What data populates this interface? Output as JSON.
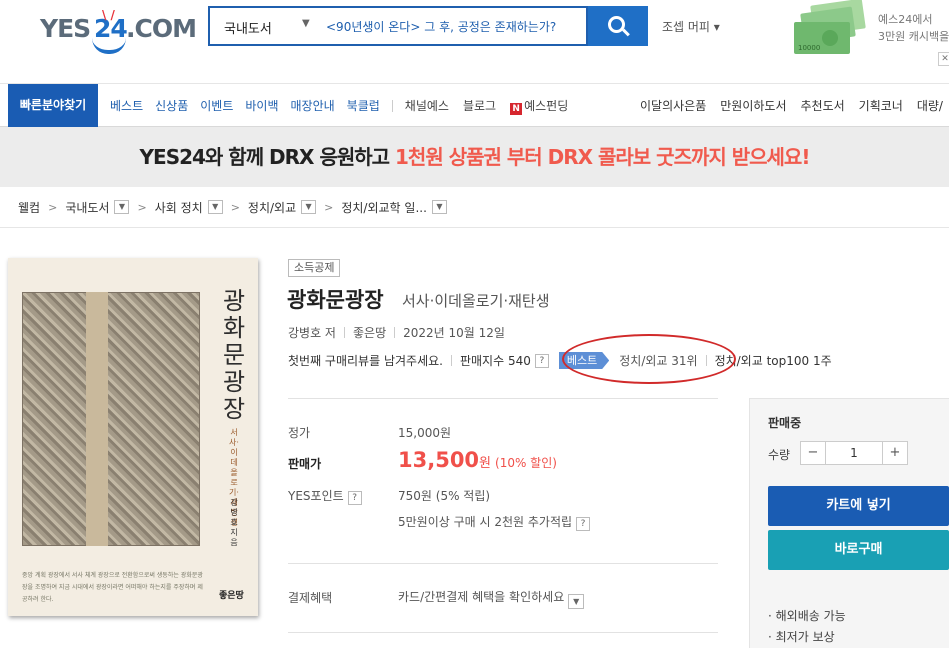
{
  "header": {
    "logo": {
      "part1": "YES",
      "part2": "24",
      "part3": ".COM"
    },
    "search": {
      "category": "국내도서",
      "value": "<90년생이 온다> 그 후, 공정은 존재하는가?"
    },
    "user_menu": "조셉 머피 ▾",
    "promo_line1": "예스24에서",
    "promo_line2": "3만원 캐시백을"
  },
  "nav": {
    "quick": "빠른분야찾기",
    "items": [
      "베스트",
      "신상품",
      "이벤트",
      "바이백",
      "매장안내",
      "북클럽"
    ],
    "channel": [
      "채널예스",
      "블로그"
    ],
    "funding": "예스펀딩",
    "right": [
      "이달의사은품",
      "만원이하도서",
      "추천도서",
      "기획코너",
      "대량/"
    ]
  },
  "banner": {
    "part1": "YES24와 함께 DRX 응원하고 ",
    "part2": "1천원 상품권 부터 DRX 콜라보 굿즈까지 받으세요!"
  },
  "breadcrumb": [
    "웰컴",
    "국내도서",
    "사회 정치",
    "정치/외교",
    "정치/외교학 일..."
  ],
  "cover": {
    "title": "광화문광장",
    "subtitle": "서사·이데올로기·재탄생",
    "author": "강병호 지음",
    "publisher": "좋은땅",
    "blurb": "중앙 계획 광장에서 서사 체계 광장으로 전환함으로써 생동하는 광화문광장을 조명하여 지금 시대에서 광장이라면 어떠해야 하는지를 주장하며 제공하려 한다."
  },
  "book": {
    "tag": "소득공제",
    "title": "광화문광장",
    "subtitle": "서사·이데올로기·재탄생",
    "author": "강병호 저",
    "publisher": "좋은땅",
    "date": "2022년 10월 12일",
    "review": "첫번째 구매리뷰를 남겨주세요.",
    "sales_index": "판매지수 540",
    "best_badge": "베스트",
    "best_rank": "정치/외교 31위",
    "top100": "정치/외교 top100 1주"
  },
  "pricing": {
    "list_label": "정가",
    "list_price": "15,000원",
    "sale_label": "판매가",
    "sale_price": "13,500",
    "won": "원",
    "discount": "(10% 할인)",
    "points_label": "YES포인트",
    "points": "750원 (5% 적립)",
    "extra_points": "5만원이상 구매 시 2천원 추가적립",
    "pay_label": "결제혜택",
    "pay_value": "카드/간편결제 혜택을 확인하세요"
  },
  "purchase": {
    "status": "판매중",
    "qty_label": "수량",
    "qty": "1",
    "cart": "카트에 넣기",
    "buy": "바로구매",
    "notes": [
      "· 해외배송 가능",
      "· 최저가 보상"
    ]
  }
}
